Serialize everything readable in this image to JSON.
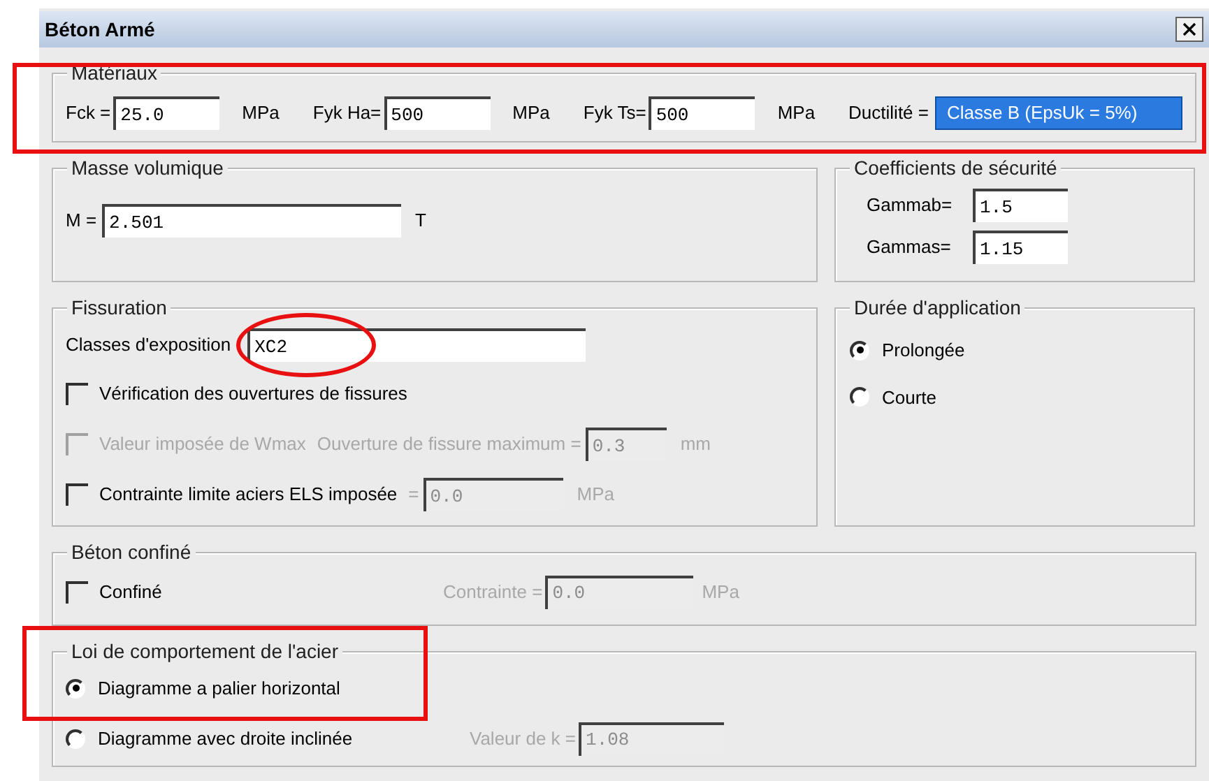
{
  "window": {
    "title": "Béton Armé"
  },
  "materials": {
    "title": "Matériaux",
    "highlight": true,
    "fields": [
      {
        "label": "Fck =",
        "value": "25.0",
        "unit": "MPa"
      },
      {
        "label": "Fyk Ha=",
        "value": "500",
        "unit": "MPa"
      },
      {
        "label": "Fyk Ts=",
        "value": "500",
        "unit": "MPa"
      }
    ],
    "ductility": {
      "label": "Ductilité =",
      "value": "Classe B (EpsUk = 5%)"
    }
  },
  "density": {
    "title": "Masse volumique",
    "label": "M =",
    "value": "2.501",
    "unit": "T"
  },
  "safety": {
    "title": "Coefficients de sécurité",
    "fields": [
      {
        "label": "Gammab=",
        "value": "1.5"
      },
      {
        "label": "Gammas=",
        "value": "1.15"
      }
    ]
  },
  "cracking": {
    "title": "Fissuration",
    "exposure": {
      "label": "Classes d'exposition",
      "value": "XC2",
      "highlight": true
    },
    "options": [
      {
        "label": "Vérification des ouvertures de fissures",
        "checked": false,
        "disabled": false
      },
      {
        "label": "Valeur imposée de Wmax",
        "checked": false,
        "disabled": true,
        "field": {
          "label": "Ouverture de fissure maximum =",
          "value": "0.3",
          "unit": "mm",
          "disabled": true
        }
      },
      {
        "label": "Contrainte limite aciers ELS imposée",
        "checked": false,
        "disabled": false,
        "field": {
          "label": "=",
          "value": "0.0",
          "unit": "MPa",
          "disabled": true
        }
      }
    ]
  },
  "duration": {
    "title": "Durée d'application",
    "options": [
      {
        "label": "Prolongée",
        "selected": true
      },
      {
        "label": "Courte",
        "selected": false
      }
    ]
  },
  "confined": {
    "title": "Béton confiné",
    "option": {
      "label": "Confiné",
      "checked": false
    },
    "field": {
      "label": "Contrainte =",
      "value": "0.0",
      "unit": "MPa",
      "disabled": true
    }
  },
  "steel_law": {
    "title": "Loi de comportement de l'acier",
    "highlight": true,
    "options": [
      {
        "label": "Diagramme a palier horizontal",
        "selected": true
      },
      {
        "label": "Diagramme avec droite inclinée",
        "selected": false,
        "field": {
          "label": "Valeur de k =",
          "value": "1.08",
          "disabled": true
        }
      }
    ]
  }
}
